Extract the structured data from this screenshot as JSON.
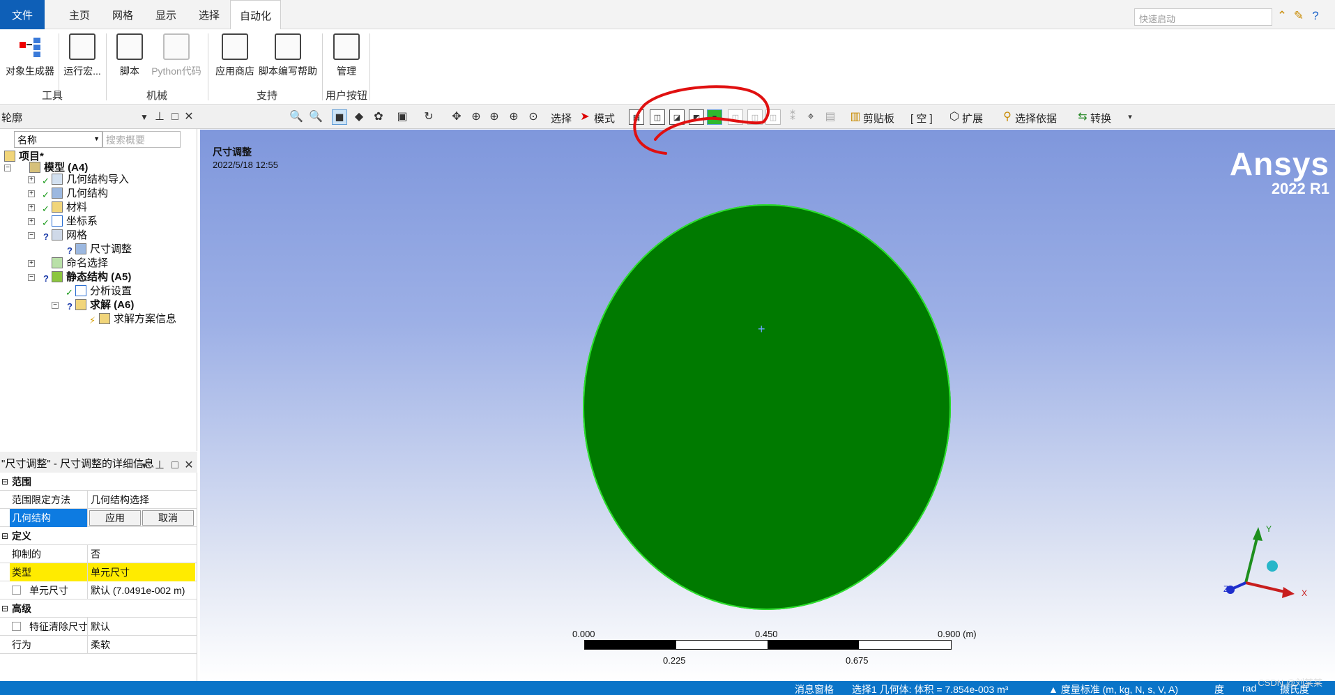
{
  "tabs": [
    {
      "label": "文件"
    },
    {
      "label": "主页"
    },
    {
      "label": "网格"
    },
    {
      "label": "显示"
    },
    {
      "label": "选择"
    },
    {
      "label": "自动化"
    }
  ],
  "quick_launch_placeholder": "快速启动",
  "ribbon": {
    "buttons": [
      {
        "label": "对象生成器"
      },
      {
        "label": "运行宏..."
      },
      {
        "label": "脚本"
      },
      {
        "label": "Python代码"
      },
      {
        "label": "应用商店"
      },
      {
        "label": "脚本编写帮助"
      },
      {
        "label": "管理"
      }
    ],
    "groups": [
      "工具",
      "机械",
      "支持",
      "用户按钮"
    ]
  },
  "toolbar": {
    "select_label": "选择",
    "mode_label": "模式",
    "clipboard_label": "剪贴板",
    "empty_label": "[ 空 ]",
    "extend_label": "扩展",
    "select_by_label": "选择依据",
    "convert_label": "转换"
  },
  "outline": {
    "title": "轮廓",
    "filter_select": "名称",
    "search_placeholder": "搜索概要",
    "tree": [
      {
        "label": "项目*",
        "status": ""
      },
      {
        "label": "模型 (A4)",
        "status": ""
      },
      {
        "label": "几何结构导入",
        "status": "ok"
      },
      {
        "label": "几何结构",
        "status": "ok"
      },
      {
        "label": "材料",
        "status": "ok"
      },
      {
        "label": "坐标系",
        "status": "ok"
      },
      {
        "label": "网格",
        "status": "?"
      },
      {
        "label": "尺寸调整",
        "status": "?"
      },
      {
        "label": "命名选择",
        "status": ""
      },
      {
        "label": "静态结构 (A5)",
        "status": "?"
      },
      {
        "label": "分析设置",
        "status": "ok"
      },
      {
        "label": "求解 (A6)",
        "status": "?"
      },
      {
        "label": "求解方案信息",
        "status": "bolt"
      }
    ]
  },
  "details": {
    "title": "\"尺寸调整\" - 尺寸调整的详细信息",
    "rows": [
      {
        "label": "范围",
        "value": ""
      },
      {
        "label": "范围限定方法",
        "value": "几何结构选择"
      },
      {
        "label": "几何结构",
        "value": ""
      },
      {
        "label": "定义",
        "value": ""
      },
      {
        "label": "抑制的",
        "value": "否"
      },
      {
        "label": "类型",
        "value": "单元尺寸"
      },
      {
        "label": "单元尺寸",
        "value": "默认 (7.0491e-002 m)"
      },
      {
        "label": "高级",
        "value": ""
      },
      {
        "label": "特征清除尺寸",
        "value": "默认"
      },
      {
        "label": "行为",
        "value": "柔软"
      }
    ],
    "apply_label": "应用",
    "cancel_label": "取消"
  },
  "viewport": {
    "title": "尺寸调整",
    "date": "2022/5/18 12:55",
    "logo_name": "Ansys",
    "logo_version": "2022 R1",
    "mesh_color": "#007a00",
    "scale": {
      "top_labels": [
        "0.000",
        "0.450",
        "0.900 (m)"
      ],
      "bottom_labels": [
        "0.225",
        "0.675"
      ]
    },
    "triad": {
      "x": "X",
      "y": "Y",
      "z": "Z"
    }
  },
  "status": {
    "messages": "消息窗格",
    "selection": "选择1 几何体: 体积 = 7.854e-003 m³",
    "units": "度量标准 (m, kg, N, s, V, A)",
    "angle": "度",
    "rad": "rad",
    "temp": "摄氏度",
    "watermark": "CSDN @刘某某"
  }
}
